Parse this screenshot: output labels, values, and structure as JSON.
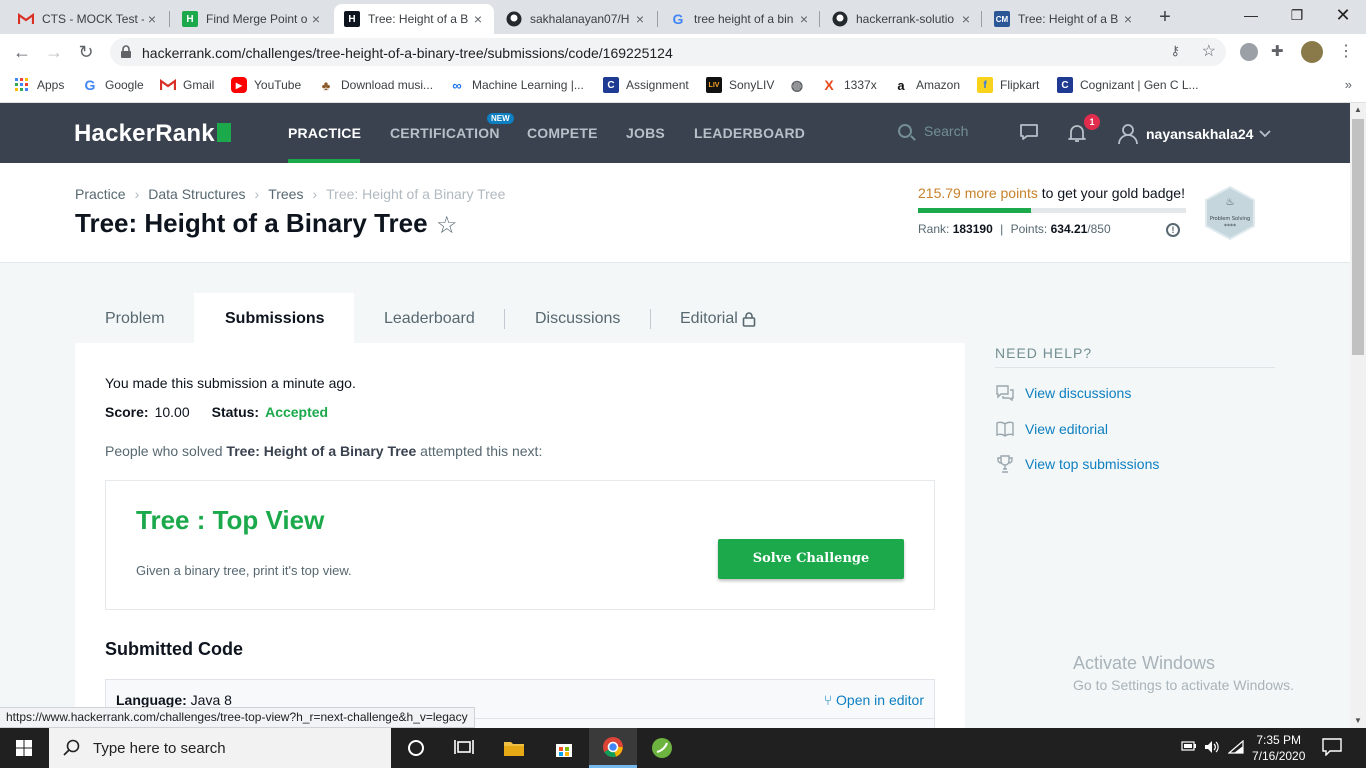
{
  "browser": {
    "tabs": [
      {
        "title": "CTS - MOCK Test -",
        "icon": "gmail-icon",
        "active": false
      },
      {
        "title": "Find Merge Point o",
        "icon": "hackerrank-icon",
        "active": false
      },
      {
        "title": "Tree: Height of a B",
        "icon": "hackerrank-icon",
        "active": true
      },
      {
        "title": "sakhalanayan07/H",
        "icon": "github-icon",
        "active": false
      },
      {
        "title": "tree height of a bin",
        "icon": "google-icon",
        "active": false
      },
      {
        "title": "hackerrank-solutio",
        "icon": "github-icon",
        "active": false
      },
      {
        "title": "Tree: Height of a B",
        "icon": "cm-icon",
        "active": false
      }
    ],
    "url": "hackerrank.com/challenges/tree-height-of-a-binary-tree/submissions/code/169225124",
    "bookmarks": [
      {
        "label": "Apps",
        "icon": "apps-icon"
      },
      {
        "label": "Google",
        "icon": "google-icon"
      },
      {
        "label": "Gmail",
        "icon": "gmail-icon"
      },
      {
        "label": "YouTube",
        "icon": "youtube-icon"
      },
      {
        "label": "Download musi...",
        "icon": "music-icon"
      },
      {
        "label": "Machine Learning |...",
        "icon": "ml-icon"
      },
      {
        "label": "Assignment",
        "icon": "c-icon"
      },
      {
        "label": "SonyLIV",
        "icon": "sonyliv-icon"
      },
      {
        "label": "",
        "icon": "globe-icon"
      },
      {
        "label": "1337x",
        "icon": "x-icon"
      },
      {
        "label": "Amazon",
        "icon": "amazon-icon"
      },
      {
        "label": "Flipkart",
        "icon": "flipkart-icon"
      },
      {
        "label": "Cognizant | Gen C L...",
        "icon": "c-icon"
      }
    ],
    "bookmarks_more": "»",
    "status_url": "https://www.hackerrank.com/challenges/tree-top-view?h_r=next-challenge&h_v=legacy"
  },
  "hr": {
    "logo": "HackerRank",
    "nav": {
      "practice": "PRACTICE",
      "certification": "CERTIFICATION",
      "certification_badge": "NEW",
      "compete": "COMPETE",
      "jobs": "JOBS",
      "leaderboard": "LEADERBOARD"
    },
    "search_placeholder": "Search",
    "notifications_count": "1",
    "username": "nayansakhala24"
  },
  "page": {
    "breadcrumb": [
      "Practice",
      "Data Structures",
      "Trees",
      "Tree: Height of a Binary Tree"
    ],
    "title": "Tree: Height of a Binary Tree",
    "badge_points": "215.79 more points",
    "badge_text": " to get your gold badge!",
    "badge_progress_percent": 42,
    "rank_label": "Rank:",
    "rank_value": "183190",
    "points_label": "Points:",
    "points_value": "634.21",
    "points_total": "/850",
    "hex_badge_text": "Problem Solving",
    "hex_badge_stars": "****"
  },
  "tabs": {
    "problem": "Problem",
    "submissions": "Submissions",
    "leaderboard": "Leaderboard",
    "discussions": "Discussions",
    "editorial": "Editorial"
  },
  "submission": {
    "message": "You made this submission a minute ago.",
    "score_label": "Score:",
    "score_value": "10.00",
    "status_label": "Status:",
    "status_value": "Accepted",
    "people_prefix": "People who solved ",
    "people_challenge": "Tree: Height of a Binary Tree",
    "people_suffix": " attempted this next:",
    "next_title": "Tree : Top View",
    "next_desc": "Given a binary tree, print it's top view.",
    "solve_button": "Solve Challenge",
    "submitted_code": "Submitted Code",
    "language_label": "Language:",
    "language_value": "Java 8",
    "open_in_editor": "Open in editor"
  },
  "help": {
    "heading": "NEED HELP?",
    "links": [
      "View discussions",
      "View editorial",
      "View top submissions"
    ]
  },
  "watermark": {
    "line1": "Activate Windows",
    "line2": "Go to Settings to activate Windows."
  },
  "taskbar": {
    "search_placeholder": "Type here to search",
    "time": "7:35 PM",
    "date": "7/16/2020"
  },
  "colors": {
    "hr_green": "#1ba94c",
    "hr_nav_bg": "#39424e",
    "link_blue": "#0e7fc1",
    "badge_orange": "#c5822a"
  }
}
